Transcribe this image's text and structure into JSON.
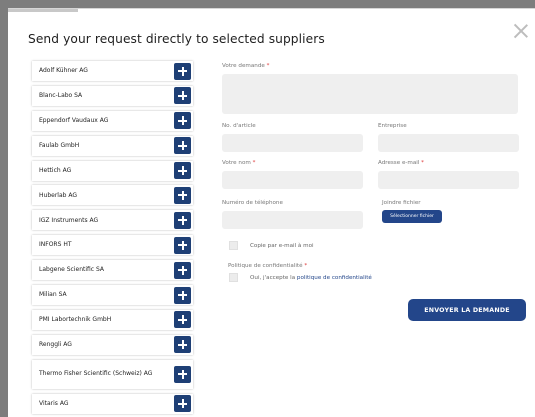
{
  "modal": {
    "title": "Send your request directly to selected suppliers",
    "close_icon": "close-icon"
  },
  "suppliers": [
    {
      "name": "Adolf Kühner AG"
    },
    {
      "name": "Blanc-Labo SA"
    },
    {
      "name": "Eppendorf Vaudaux AG"
    },
    {
      "name": "Faulab GmbH"
    },
    {
      "name": "Hettich AG"
    },
    {
      "name": "Huberlab AG"
    },
    {
      "name": "IGZ Instruments AG"
    },
    {
      "name": "INFORS HT"
    },
    {
      "name": "Labgene Scientific SA"
    },
    {
      "name": "Milian SA"
    },
    {
      "name": "PMI Labortechnik GmbH"
    },
    {
      "name": "Renggli AG"
    },
    {
      "name": "Thermo Fisher Scientific (Schweiz) AG"
    },
    {
      "name": "Vitaris AG"
    }
  ],
  "form": {
    "demande_label": "Votre demande",
    "article_label": "No. d'article",
    "entreprise_label": "Entreprise",
    "nom_label": "Votre nom",
    "email_label": "Adresse e-mail",
    "telephone_label": "Numéro de téléphone",
    "fichier_label": "Joindre fichier",
    "fichier_button": "Sélectionner fichier",
    "copie_label": "Copie par e-mail à moi",
    "politique_label": "Politique de confidentialité",
    "accept_prefix": "Oui, j'accepte la",
    "accept_link": "politique de confidentialité",
    "submit_label": "ENVOYER LA DEMANDE",
    "required_mark": "*"
  },
  "colors": {
    "accent": "#23468a",
    "plus_button": "#1e3f75"
  }
}
